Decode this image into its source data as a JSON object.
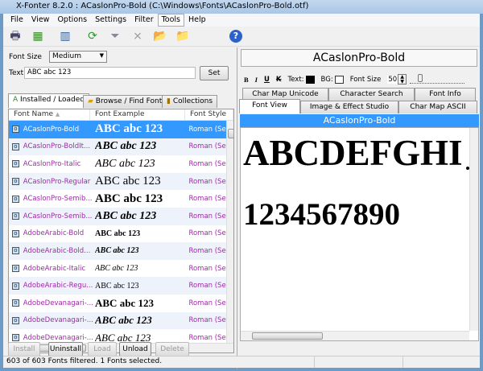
{
  "window": {
    "title": "X-Fonter 8.2.0  :  ACaslonPro-Bold (C:\\Windows\\Fonts\\ACaslonPro-Bold.otf)"
  },
  "menu": [
    "File",
    "View",
    "Options",
    "Settings",
    "Filter",
    "Tools",
    "Help"
  ],
  "toolbar": {
    "icons": [
      "print-icon",
      "spreadsheet-icon",
      "catalog-icon",
      "refresh-icon",
      "filter-icon",
      "clear-filter-icon",
      "install-icon",
      "export-icon",
      "help-icon"
    ]
  },
  "left": {
    "font_size_label": "Font Size",
    "font_size_value": "Medium",
    "text_label": "Text",
    "text_value": "ABC abc 123",
    "set_label": "Set",
    "tabs": [
      "Installed / Loaded",
      "Browse / Find Fonts",
      "Collections"
    ],
    "columns": [
      "Font Name",
      "Font Example",
      "Font Style"
    ],
    "rows": [
      {
        "name": "ACaslonPro-Bold",
        "example": "ABC abc 123",
        "style": "Roman (Se"
      },
      {
        "name": "ACaslonPro-BoldIt...",
        "example": "ABC abc 123",
        "style": "Roman (Se"
      },
      {
        "name": "ACaslonPro-Italic",
        "example": "ABC abc 123",
        "style": "Roman (Se"
      },
      {
        "name": "ACaslonPro-Regular",
        "example": "ABC abc 123",
        "style": "Roman (Se"
      },
      {
        "name": "ACaslonPro-Semib...",
        "example": "ABC abc 123",
        "style": "Roman (Se"
      },
      {
        "name": "ACaslonPro-Semib...",
        "example": "ABC abc 123",
        "style": "Roman (Se"
      },
      {
        "name": "AdobeArabic-Bold",
        "example": "ABC abc 123",
        "style": "Roman (Se"
      },
      {
        "name": "AdobeArabic-Bold...",
        "example": "ABC abc 123",
        "style": "Roman (Se"
      },
      {
        "name": "AdobeArabic-Italic",
        "example": "ABC abc 123",
        "style": "Roman (Se"
      },
      {
        "name": "AdobeArabic-Regu...",
        "example": "ABC abc 123",
        "style": "Roman (Se"
      },
      {
        "name": "AdobeDevanagari-...",
        "example": "ABC abc 123",
        "style": "Roman (Se"
      },
      {
        "name": "AdobeDevanagari-...",
        "example": "ABC abc 123",
        "style": "Roman (Se"
      },
      {
        "name": "AdobeDevanagari-...",
        "example": "ABC abc 123",
        "style": "Roman (Se"
      }
    ],
    "buttons": [
      "Install",
      "Uninstall",
      "Load",
      "Unload",
      "Delete"
    ]
  },
  "right": {
    "font_name": "ACaslonPro-Bold",
    "format": {
      "bold": "B",
      "italic": "I",
      "underline": "U",
      "strike": "K",
      "text_label": "Text:",
      "bg_label": "BG:",
      "size_label": "Font Size",
      "size_value": "50",
      "text_color": "#000000",
      "bg_color": "#ffffff"
    },
    "tabs_row1": [
      "Char Map Unicode",
      "Character Search",
      "Font Info"
    ],
    "tabs_row2": [
      "Font View",
      "Image & Effect Studio",
      "Char Map ASCII"
    ],
    "header": "ACaslonPro-Bold",
    "preview_line1": "ABCDEFGHI",
    "preview_line2": "1234567890"
  },
  "status": {
    "text": "603 of 603 Fonts filtered.   1 Fonts selected."
  },
  "colors": {
    "accent": "#3399ff",
    "font_name": "#a028a8"
  }
}
